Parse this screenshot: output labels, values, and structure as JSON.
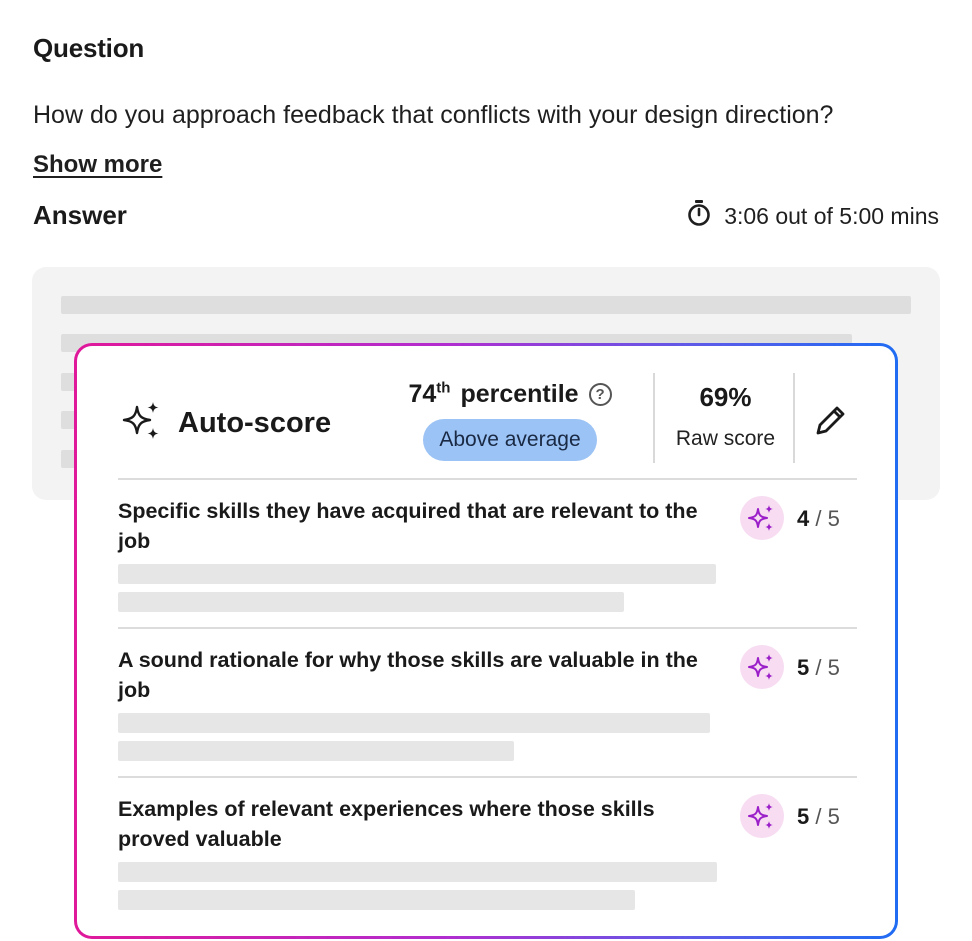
{
  "question": {
    "heading": "Question",
    "text": "How do you approach feedback that conflicts with your design direction?",
    "show_more": "Show more"
  },
  "answer": {
    "heading": "Answer",
    "timer": "3:06 out of 5:00 mins"
  },
  "autoscore": {
    "label": "Auto-score",
    "percentile_number": "74",
    "percentile_suffix": "th",
    "percentile_word": "percentile",
    "help_glyph": "?",
    "badge": "Above average",
    "raw_score_value": "69%",
    "raw_score_label": "Raw score",
    "icons": {
      "sparkle": "sparkle-icon",
      "edit": "pencil-icon",
      "help": "help-icon",
      "timer": "stopwatch-icon"
    }
  },
  "criteria": [
    {
      "title": "Specific skills they have acquired that are relevant to the job",
      "score": "4",
      "max": "5"
    },
    {
      "title": "A sound rationale for why those skills are valuable in the job",
      "score": "5",
      "max": "5"
    },
    {
      "title": "Examples of relevant experiences where those skills proved valuable",
      "score": "5",
      "max": "5"
    }
  ],
  "score_separator": " / ",
  "colors": {
    "border_gradient_start": "#e0189a",
    "border_gradient_end": "#1f6cf3",
    "badge_blue": "#9cc3f5",
    "sparkle_purple": "#9b1fc9",
    "sparkle_badge_bg": "#f7dcf2",
    "answer_box_bg": "#f3f3f3"
  }
}
